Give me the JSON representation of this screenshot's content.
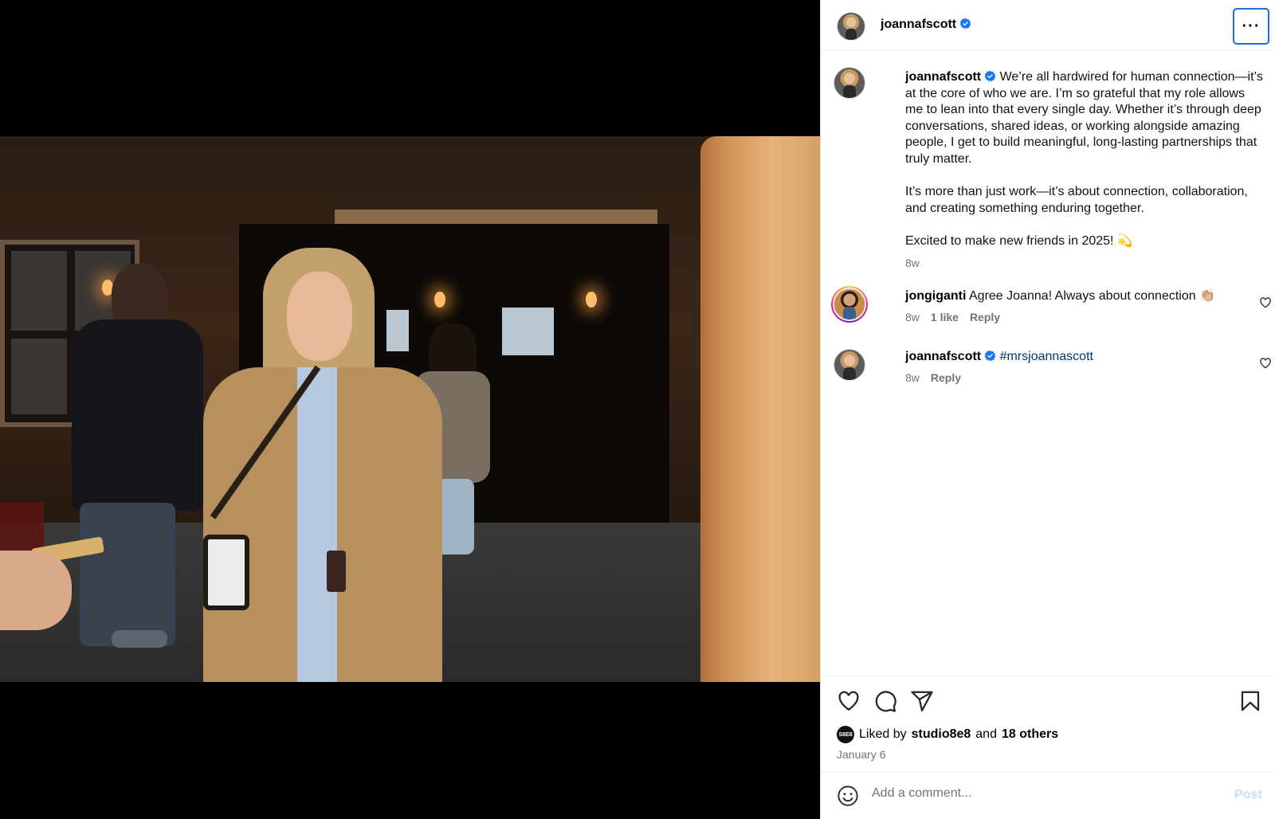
{
  "colors": {
    "verified": "#1877F2",
    "link": "#00376B",
    "muted": "#737373",
    "post_disabled": "#C3DFFA",
    "focus_outline": "#1C6ED8"
  },
  "header": {
    "username": "joannafscott",
    "more_icon": "more-horizontal-icon",
    "more_label": "···"
  },
  "caption": {
    "username": "joannafscott",
    "paragraphs": [
      "We’re all hardwired for human connection—it’s at the core of who we are. I’m so grateful that my role allows me to lean into that every single day. Whether it’s through deep conversations, shared ideas, or working alongside amazing people, I get to build meaningful, long-lasting partnerships that truly matter.",
      "It’s more than just work—it’s about connection, collaboration, and creating something enduring together.",
      "Excited to make new friends in 2025! 💫"
    ],
    "time": "8w"
  },
  "comments": [
    {
      "username": "jongiganti",
      "text": "Agree Joanna! Always about connection 👏🏼",
      "time": "8w",
      "likes": "1 like",
      "reply": "Reply"
    },
    {
      "username": "joannafscott",
      "text": "#mrsjoannascott",
      "time": "8w",
      "reply": "Reply"
    }
  ],
  "actions": {
    "icons": [
      "heart-icon",
      "comment-icon",
      "share-icon",
      "bookmark-icon"
    ],
    "liked_by_prefix": "Liked by",
    "liked_by_user": "studio8e8",
    "liked_by_and": "and",
    "liked_by_others": "18 others",
    "liked_by_logo": "S8E8",
    "date": "January 6"
  },
  "comment_box": {
    "placeholder": "Add a comment...",
    "post_label": "Post"
  }
}
